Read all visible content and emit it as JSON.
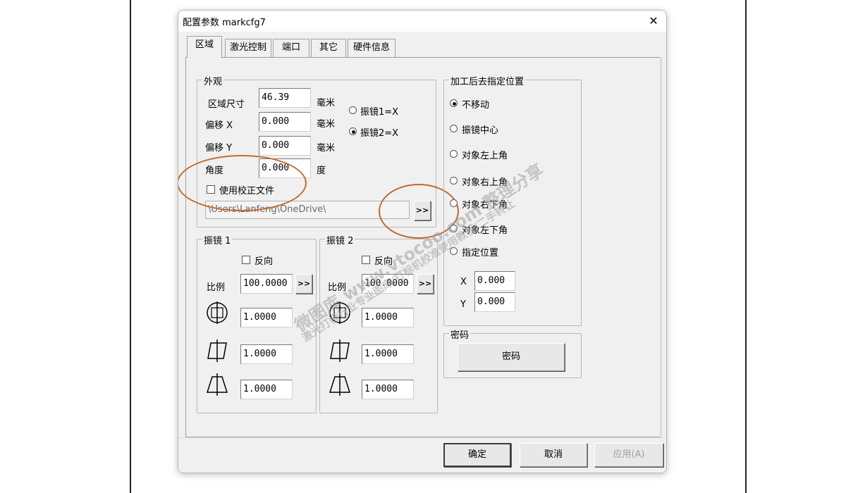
{
  "window": {
    "title": "配置参数 markcfg7",
    "close_symbol": "✕"
  },
  "tabs": [
    {
      "label": "区域",
      "active": true
    },
    {
      "label": "激光控制",
      "active": false
    },
    {
      "label": "端口",
      "active": false
    },
    {
      "label": "其它",
      "active": false
    },
    {
      "label": "硬件信息",
      "active": false
    }
  ],
  "appearance": {
    "group_label": "外观",
    "area_size": {
      "label": "区域尺寸",
      "value": "46.39",
      "unit": "毫米"
    },
    "offset_x": {
      "label": "偏移 X",
      "value": "0.000",
      "unit": "毫米"
    },
    "offset_y": {
      "label": "偏移 Y",
      "value": "0.000",
      "unit": "毫米"
    },
    "angle": {
      "label": "角度",
      "value": "0.000",
      "unit": "度"
    },
    "galvo1_x": {
      "label": "振镜1=X",
      "checked": false
    },
    "galvo2_x": {
      "label": "振镜2=X",
      "checked": true
    },
    "use_correction": {
      "label": "使用校正文件",
      "checked": false
    },
    "correction_path": "\\Users\\Lanfeng\\OneDrive\\",
    "browse_label": ">>"
  },
  "galvo1": {
    "group_label": "振镜 1",
    "reverse": {
      "label": "反向",
      "checked": false
    },
    "scale": {
      "label": "比例",
      "value": "100.0000"
    },
    "scale_btn": ">>",
    "circle_value": "1.0000",
    "parallelogram_value": "1.0000",
    "trapezoid_value": "1.0000"
  },
  "galvo2": {
    "group_label": "振镜 2",
    "reverse": {
      "label": "反向",
      "checked": false
    },
    "scale": {
      "label": "比例",
      "value": "100.0000"
    },
    "scale_btn": ">>",
    "circle_value": "1.0000",
    "parallelogram_value": "1.0000",
    "trapezoid_value": "1.0000"
  },
  "after_process": {
    "group_label": "加工后去指定位置",
    "options": [
      {
        "label": "不移动",
        "checked": true
      },
      {
        "label": "振镜中心",
        "checked": false
      },
      {
        "label": "对象左上角",
        "checked": false
      },
      {
        "label": "对象右上角",
        "checked": false
      },
      {
        "label": "对象右下角",
        "checked": false
      },
      {
        "label": "对象左下角",
        "checked": false
      },
      {
        "label": "指定位置",
        "checked": false
      }
    ],
    "x": {
      "label": "X",
      "value": "0.000"
    },
    "y": {
      "label": "Y",
      "value": "0.000"
    }
  },
  "password": {
    "group_label": "密码",
    "button_label": "密码"
  },
  "buttons": {
    "ok": "确定",
    "cancel": "取消",
    "apply": "应用(A)"
  },
  "watermark": {
    "line1": "微图库 www.vtocoo.com 整理分享",
    "line2": "激光打标行业专业图库/打标机校准使用教程/二手转让"
  },
  "colors": {
    "annotation": "#c36a2d",
    "dialog_bg": "#f0f0f0"
  }
}
